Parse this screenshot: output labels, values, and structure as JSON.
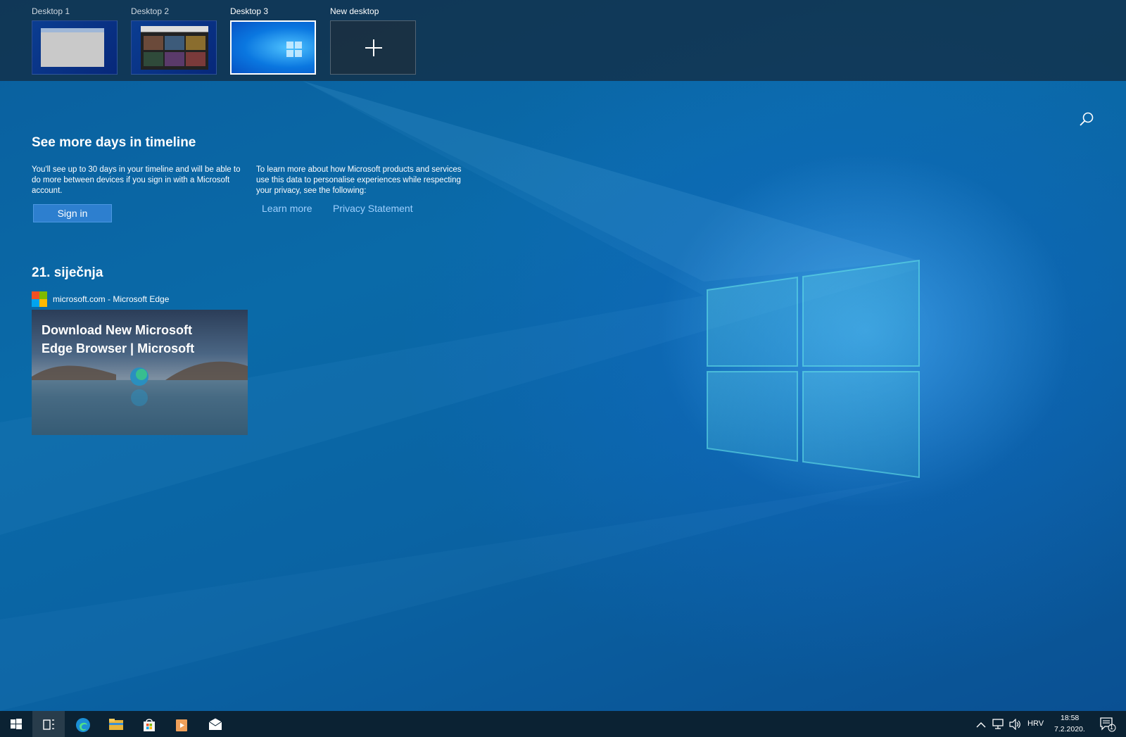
{
  "desktops": [
    {
      "label": "Desktop 1",
      "active": false
    },
    {
      "label": "Desktop 2",
      "active": false
    },
    {
      "label": "Desktop 3",
      "active": true
    }
  ],
  "new_desktop_label": "New desktop",
  "promo": {
    "title": "See more days in timeline",
    "left_text": "You'll see up to 30 days in your timeline and will be able to do more between devices if you sign in with a Microsoft account.",
    "right_text": "To learn more about how Microsoft products and services use this data to personalise experiences while respecting your privacy, see the following:",
    "signin_label": "Sign in",
    "learn_more_label": "Learn more",
    "privacy_label": "Privacy Statement"
  },
  "timeline": {
    "date": "21. siječnja",
    "activity": {
      "source": "microsoft.com - Microsoft Edge",
      "title": "Download New Microsoft Edge Browser | Microsoft"
    }
  },
  "taskbar": {
    "apps": [
      "start-icon",
      "task-view-icon",
      "edge-icon",
      "file-explorer-icon",
      "store-icon",
      "media-player-icon",
      "mail-icon"
    ],
    "language": "HRV",
    "time": "18:58",
    "date": "7.2.2020.",
    "notification_count": "1"
  },
  "colors": {
    "accent": "#2d7fcf",
    "link": "#9fd0ff",
    "taskbar": "#0b2233"
  }
}
